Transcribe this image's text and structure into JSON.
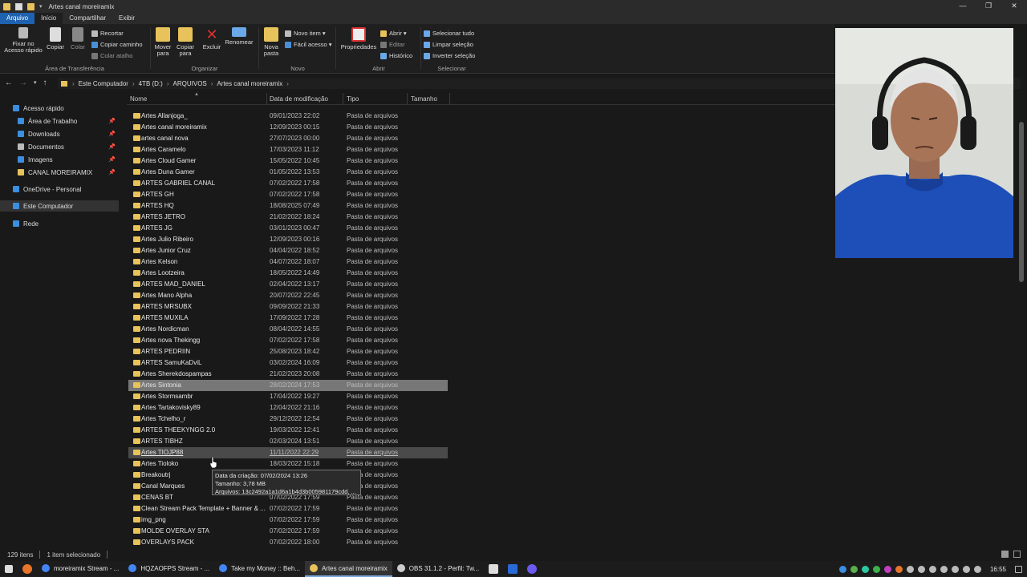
{
  "window": {
    "title": "Artes canal moreiramix"
  },
  "ribbon_tabs": [
    "Arquivo",
    "Início",
    "Compartilhar",
    "Exibir"
  ],
  "ribbon": {
    "pin": "Fixar no Acesso rápido",
    "copy": "Copiar",
    "paste": "Colar",
    "cut": "Recortar",
    "copy_path": "Copiar caminho",
    "paste_shortcut": "Colar atalho",
    "group_clipboard": "Área de Transferência",
    "move_to": "Mover para",
    "copy_to": "Copiar para",
    "delete": "Excluir",
    "rename": "Renomear",
    "group_organize": "Organizar",
    "new_folder": "Nova pasta",
    "new_item": "Novo item",
    "easy_access": "Fácil acesso",
    "group_new": "Novo",
    "properties": "Propriedades",
    "open": "Abrir",
    "edit": "Editar",
    "history": "Histórico",
    "group_open": "Abrir",
    "select_all": "Selecionar tudo",
    "select_none": "Limpar seleção",
    "invert_selection": "Inverter seleção",
    "group_select": "Selecionar"
  },
  "breadcrumb": [
    "Este Computador",
    "4TB (D:)",
    "ARQUIVOS",
    "Artes canal moreiramix"
  ],
  "nav_pane": [
    {
      "label": "Acesso rápido",
      "icon": "star-icon",
      "color": "#3b8ee0",
      "pinned": false,
      "indent": 1,
      "selected": false
    },
    {
      "label": "Área de Trabalho",
      "icon": "desktop-icon",
      "color": "#3b8ee0",
      "pinned": true,
      "indent": 2,
      "selected": false
    },
    {
      "label": "Downloads",
      "icon": "download-icon",
      "color": "#3b8ee0",
      "pinned": true,
      "indent": 2,
      "selected": false
    },
    {
      "label": "Documentos",
      "icon": "documents-icon",
      "color": "#bbbbbb",
      "pinned": true,
      "indent": 2,
      "selected": false
    },
    {
      "label": "Imagens",
      "icon": "pictures-icon",
      "color": "#3b8ee0",
      "pinned": true,
      "indent": 2,
      "selected": false
    },
    {
      "label": "CANAL MOREIRAMIX",
      "icon": "folder-icon",
      "color": "#e8c25a",
      "pinned": true,
      "indent": 2,
      "selected": false
    },
    {
      "label": "OneDrive - Personal",
      "icon": "onedrive-icon",
      "color": "#3b8ee0",
      "pinned": false,
      "indent": 1,
      "selected": false
    },
    {
      "label": "Este Computador",
      "icon": "computer-icon",
      "color": "#3b8ee0",
      "pinned": false,
      "indent": 1,
      "selected": true
    },
    {
      "label": "Rede",
      "icon": "network-icon",
      "color": "#3b8ee0",
      "pinned": false,
      "indent": 1,
      "selected": false
    }
  ],
  "columns": {
    "name": "Nome",
    "modified": "Data de modificação",
    "type": "Tipo",
    "size": "Tamanho"
  },
  "files": [
    {
      "name": "Artes Allanjoga_",
      "date": "09/01/2023 22:02",
      "type": "Pasta de arquivos"
    },
    {
      "name": "Artes canal moreiramix",
      "date": "12/09/2023 00:15",
      "type": "Pasta de arquivos"
    },
    {
      "name": "artes canal nova",
      "date": "27/07/2023 00:00",
      "type": "Pasta de arquivos"
    },
    {
      "name": "Artes Caramelo",
      "date": "17/03/2023 11:12",
      "type": "Pasta de arquivos"
    },
    {
      "name": "Artes Cloud Gamer",
      "date": "15/05/2022 10:45",
      "type": "Pasta de arquivos"
    },
    {
      "name": "Artes Duna Gamer",
      "date": "01/05/2022 13:53",
      "type": "Pasta de arquivos"
    },
    {
      "name": "ARTES GABRIEL CANAL",
      "date": "07/02/2022 17:58",
      "type": "Pasta de arquivos"
    },
    {
      "name": "ARTES GH",
      "date": "07/02/2022 17:58",
      "type": "Pasta de arquivos"
    },
    {
      "name": "ARTES HQ",
      "date": "18/08/2025 07:49",
      "type": "Pasta de arquivos"
    },
    {
      "name": "ARTES JETRO",
      "date": "21/02/2022 18:24",
      "type": "Pasta de arquivos"
    },
    {
      "name": "ARTES JG",
      "date": "03/01/2023 00:47",
      "type": "Pasta de arquivos"
    },
    {
      "name": "Artes Julio Ribeiro",
      "date": "12/09/2023 00:16",
      "type": "Pasta de arquivos"
    },
    {
      "name": "Artes Junior Cruz",
      "date": "04/04/2022 18:52",
      "type": "Pasta de arquivos"
    },
    {
      "name": "Artes Kelson",
      "date": "04/07/2022 18:07",
      "type": "Pasta de arquivos"
    },
    {
      "name": "Artes Lootzeira",
      "date": "18/05/2022 14:49",
      "type": "Pasta de arquivos"
    },
    {
      "name": "ARTES MAD_DANIEL",
      "date": "02/04/2022 13:17",
      "type": "Pasta de arquivos"
    },
    {
      "name": "Artes Mano Alpha",
      "date": "20/07/2022 22:45",
      "type": "Pasta de arquivos"
    },
    {
      "name": "ARTES MRSUBX",
      "date": "09/09/2022 21:33",
      "type": "Pasta de arquivos"
    },
    {
      "name": "ARTES MUXILA",
      "date": "17/09/2022 17:28",
      "type": "Pasta de arquivos"
    },
    {
      "name": "Artes Nordicman",
      "date": "08/04/2022 14:55",
      "type": "Pasta de arquivos"
    },
    {
      "name": "Artes nova Thekingg",
      "date": "07/02/2022 17:58",
      "type": "Pasta de arquivos"
    },
    {
      "name": "ARTES PEDRIIN",
      "date": "25/08/2023 18:42",
      "type": "Pasta de arquivos"
    },
    {
      "name": "ARTES SamuKaDviL",
      "date": "03/02/2024 16:09",
      "type": "Pasta de arquivos"
    },
    {
      "name": "Artes Sherekdospampas",
      "date": "21/02/2023 20:08",
      "type": "Pasta de arquivos"
    },
    {
      "name": "Artes Sintonia",
      "date": "28/02/2024 17:53",
      "type": "Pasta de arquivos",
      "state": "sel"
    },
    {
      "name": "Artes Stormsambr",
      "date": "17/04/2022 19:27",
      "type": "Pasta de arquivos"
    },
    {
      "name": "Artes Tartakovisky89",
      "date": "12/04/2022 21:16",
      "type": "Pasta de arquivos"
    },
    {
      "name": "Artes Tchelho_r",
      "date": "29/12/2022 12:54",
      "type": "Pasta de arquivos"
    },
    {
      "name": "ARTES THEEKYNGG 2.0",
      "date": "19/03/2022 12:41",
      "type": "Pasta de arquivos"
    },
    {
      "name": "ARTES TIBHZ",
      "date": "02/03/2024 13:51",
      "type": "Pasta de arquivos"
    },
    {
      "name": "Artes TIOJP88",
      "date": "11/11/2022 22:29",
      "type": "Pasta de arquivos",
      "state": "hover"
    },
    {
      "name": "Artes Tioloko",
      "date": "18/03/2022 15:18",
      "type": "Pasta de arquivos"
    },
    {
      "name": "Breakoutrj",
      "date": "",
      "type": "Pasta de arquivos"
    },
    {
      "name": "Canal Marques",
      "date": "",
      "type": "Pasta de arquivos"
    },
    {
      "name": "CENAS BT",
      "date": "07/02/2022 17:59",
      "type": "Pasta de arquivos"
    },
    {
      "name": "Clean Stream Pack Template + Banner & ...",
      "date": "07/02/2022 17:59",
      "type": "Pasta de arquivos"
    },
    {
      "name": "img_png",
      "date": "07/02/2022 17:59",
      "type": "Pasta de arquivos"
    },
    {
      "name": "MOLDE OVERLAY STA",
      "date": "07/02/2022 17:59",
      "type": "Pasta de arquivos"
    },
    {
      "name": "OVERLAYS PACK",
      "date": "07/02/2022 18:00",
      "type": "Pasta de arquivos"
    }
  ],
  "tooltip": {
    "created": "Data da criação: 07/02/2024 13:26",
    "size": "Tamanho: 3,78 MB",
    "files": "Arquivos: 13c2492a1a1d6a1b4d3b005981179cdd, ..."
  },
  "status": {
    "count": "129 itens",
    "selected": "1 item selecionado"
  },
  "taskbar": {
    "apps": [
      {
        "label": "moreiramix Stream - ...",
        "color": "#4285f4",
        "active": false
      },
      {
        "label": "HQZAOFPS Stream - ...",
        "color": "#4285f4",
        "active": false
      },
      {
        "label": "Take my Money :: Beh...",
        "color": "#4285f4",
        "active": false
      },
      {
        "label": "Artes canal moreiramix",
        "color": "#e8c25a",
        "active": true
      },
      {
        "label": "OBS 31.1.2 - Perfil: Tw...",
        "color": "#cccccc",
        "active": false
      }
    ],
    "clock": "16:55"
  },
  "colors": {
    "accent": "#1e62b0",
    "folder": "#e8c25a",
    "selected_row": "#777777"
  }
}
